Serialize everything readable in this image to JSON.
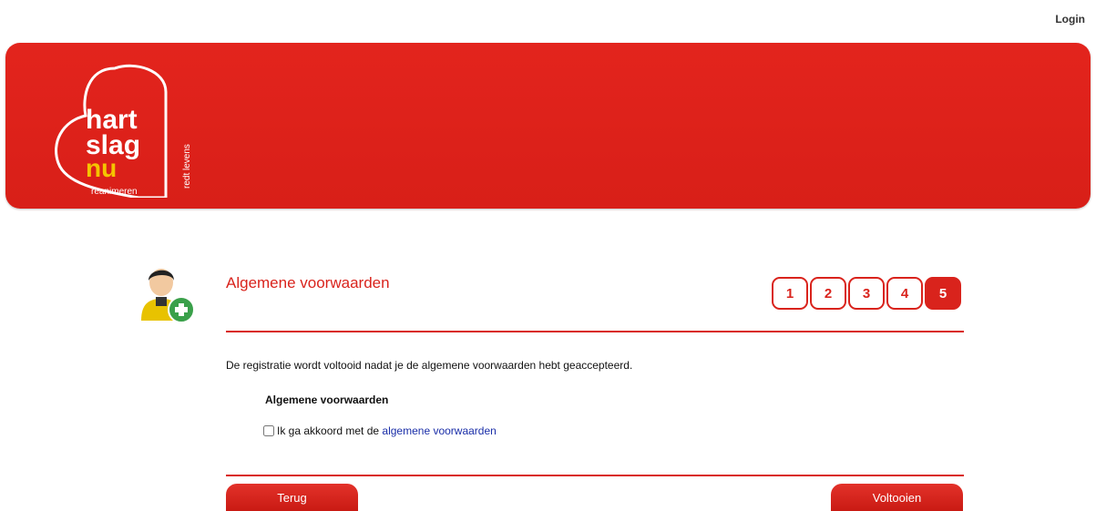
{
  "header": {
    "login_label": "Login"
  },
  "logo": {
    "line1": "hart",
    "line2": "slag",
    "line3": "nu",
    "side_text": "redt levens",
    "bottom_text": "reanimeren",
    "color": "#d9231c",
    "accent": "#f5c400"
  },
  "wizard": {
    "title": "Algemene voorwaarden",
    "steps": [
      "1",
      "2",
      "3",
      "4",
      "5"
    ],
    "active_step": 5
  },
  "main": {
    "intro_text": "De registratie wordt voltooid nadat je de algemene voorwaarden hebt geaccepteerd.",
    "terms_heading": "Algemene voorwaarden",
    "agree_prefix": "Ik ga akkoord met de ",
    "agree_link": "algemene voorwaarden",
    "agree_checked": false
  },
  "buttons": {
    "back_label": "Terug",
    "finish_label": "Voltooien"
  },
  "icons": {
    "avatar": "user-add-icon",
    "checkbox": "checkbox-icon"
  }
}
